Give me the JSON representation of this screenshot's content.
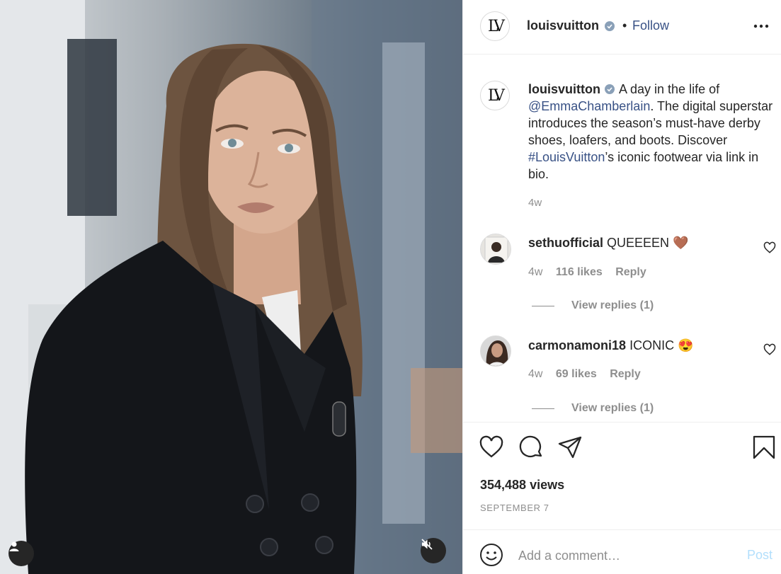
{
  "post": {
    "username": "louisvuitton",
    "logo_text": "LV",
    "follow_label": "Follow",
    "dot": "•"
  },
  "caption": {
    "username": "louisvuitton",
    "text_1": "A day in the life of",
    "mention": "@EmmaChamberlain",
    "text_2": ". The digital superstar introduces the season’s must-have derby shoes, loafers, and boots. Discover ",
    "hashtag": "#LouisVuitton",
    "text_3": "’s iconic footwear via link in bio.",
    "time": "4w"
  },
  "comments": [
    {
      "username": "sethuofficial",
      "text": "QUEEEEN",
      "emoji": "🤎",
      "time": "4w",
      "likes": "116 likes",
      "reply": "Reply",
      "view_replies": "View replies (1)"
    },
    {
      "username": "carmonamoni18",
      "text": "ICONIC",
      "emoji": "😍",
      "time": "4w",
      "likes": "69 likes",
      "reply": "Reply",
      "view_replies": "View replies (1)"
    }
  ],
  "stats": {
    "views": "354,488 views",
    "date": "SEPTEMBER 7"
  },
  "comment_box": {
    "placeholder": "Add a comment…",
    "post_label": "Post"
  },
  "colors": {
    "link": "#385185",
    "muted": "#8e8e8e",
    "post_disabled": "#b2dffc"
  }
}
